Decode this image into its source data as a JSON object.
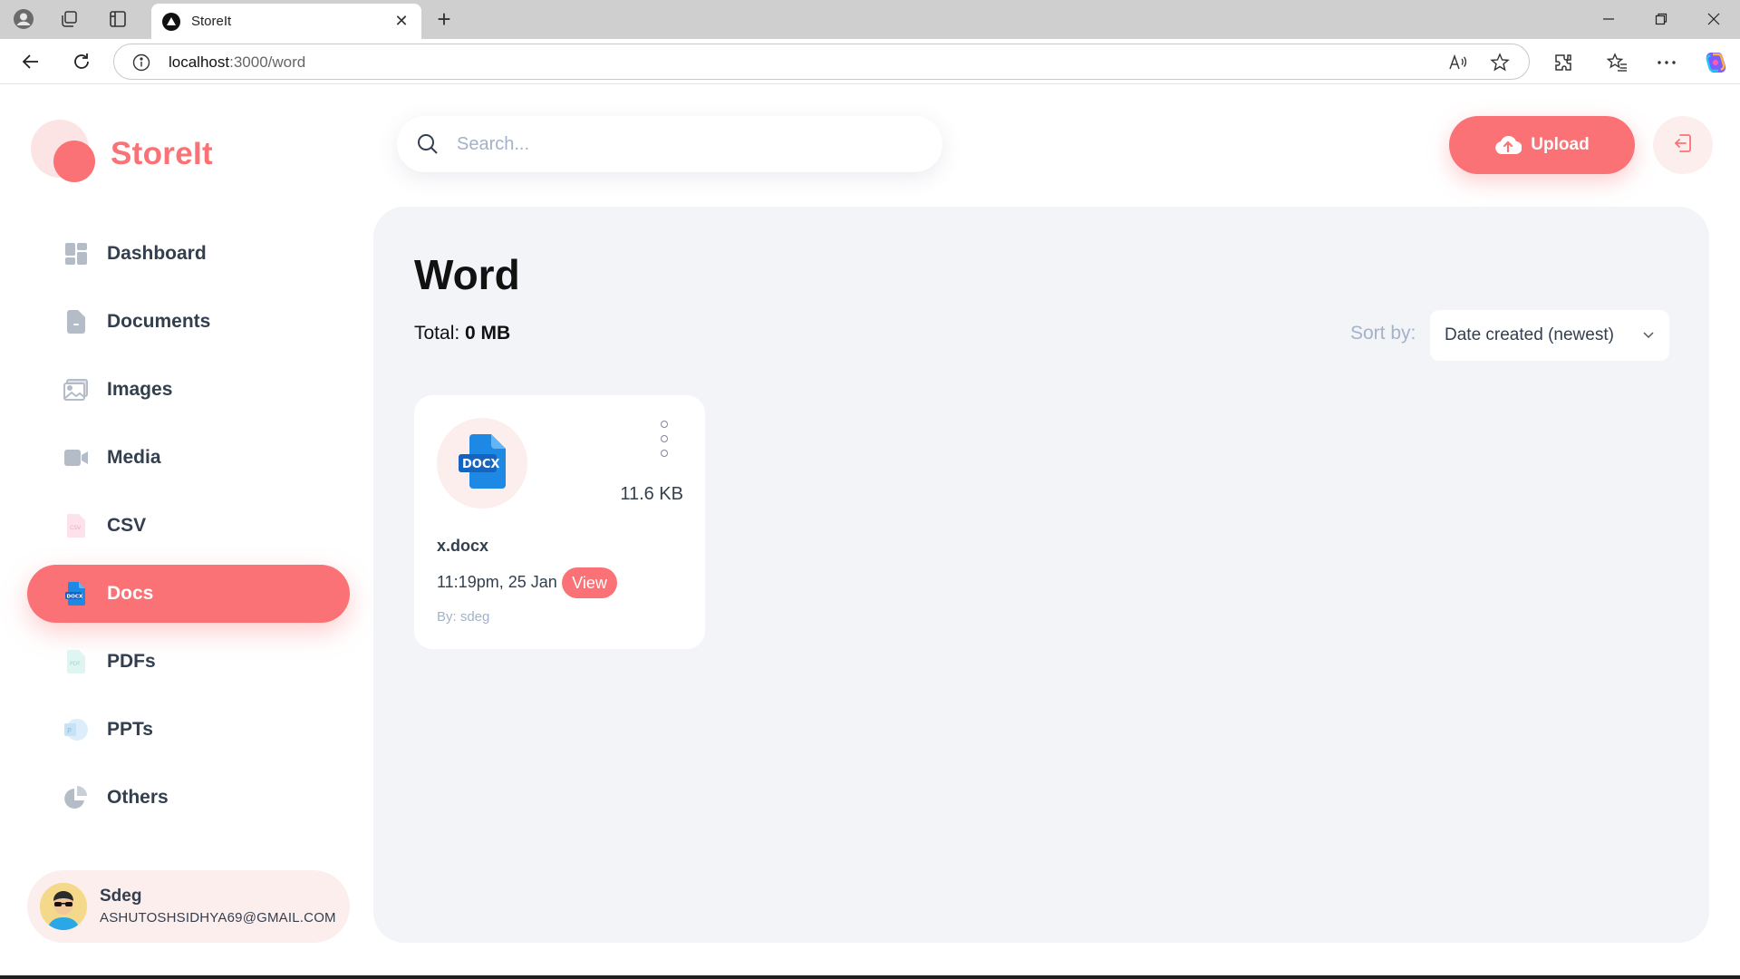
{
  "browser": {
    "tab_title": "StoreIt",
    "tab_close": "✕",
    "new_tab": "+",
    "url_host": "localhost",
    "url_path": ":3000/word"
  },
  "app": {
    "brand": "StoreIt"
  },
  "sidebar": {
    "items": [
      {
        "label": "Dashboard",
        "icon": "dashboard-icon",
        "active": false
      },
      {
        "label": "Documents",
        "icon": "documents-icon",
        "active": false
      },
      {
        "label": "Images",
        "icon": "images-icon",
        "active": false
      },
      {
        "label": "Media",
        "icon": "media-icon",
        "active": false
      },
      {
        "label": "CSV",
        "icon": "csv-icon",
        "active": false
      },
      {
        "label": "Docs",
        "icon": "docs-icon",
        "active": true
      },
      {
        "label": "PDFs",
        "icon": "pdf-icon",
        "active": false
      },
      {
        "label": "PPTs",
        "icon": "ppt-icon",
        "active": false
      },
      {
        "label": "Others",
        "icon": "others-icon",
        "active": false
      }
    ]
  },
  "user": {
    "name": "Sdeg",
    "email": "ASHUTOSHSIDHYA69@GMAIL.COM"
  },
  "header": {
    "search_placeholder": "Search...",
    "upload_label": "Upload"
  },
  "main": {
    "title": "Word",
    "total_label": "Total:",
    "total_value": "0 MB",
    "sort_label": "Sort by:",
    "sort_value": "Date created (newest)"
  },
  "files": [
    {
      "name": "x.docx",
      "size": "11.6 KB",
      "date": "11:19pm, 25 Jan",
      "view_label": "View",
      "owner": "By: sdeg",
      "badge": "DOCX"
    }
  ],
  "colors": {
    "brand": "#fa7275",
    "brand_light": "#fdeeee",
    "main_bg": "#f2f4f8",
    "text": "#333f4e",
    "muted": "#a3b2c7",
    "docx_blue": "#1e88e5"
  }
}
